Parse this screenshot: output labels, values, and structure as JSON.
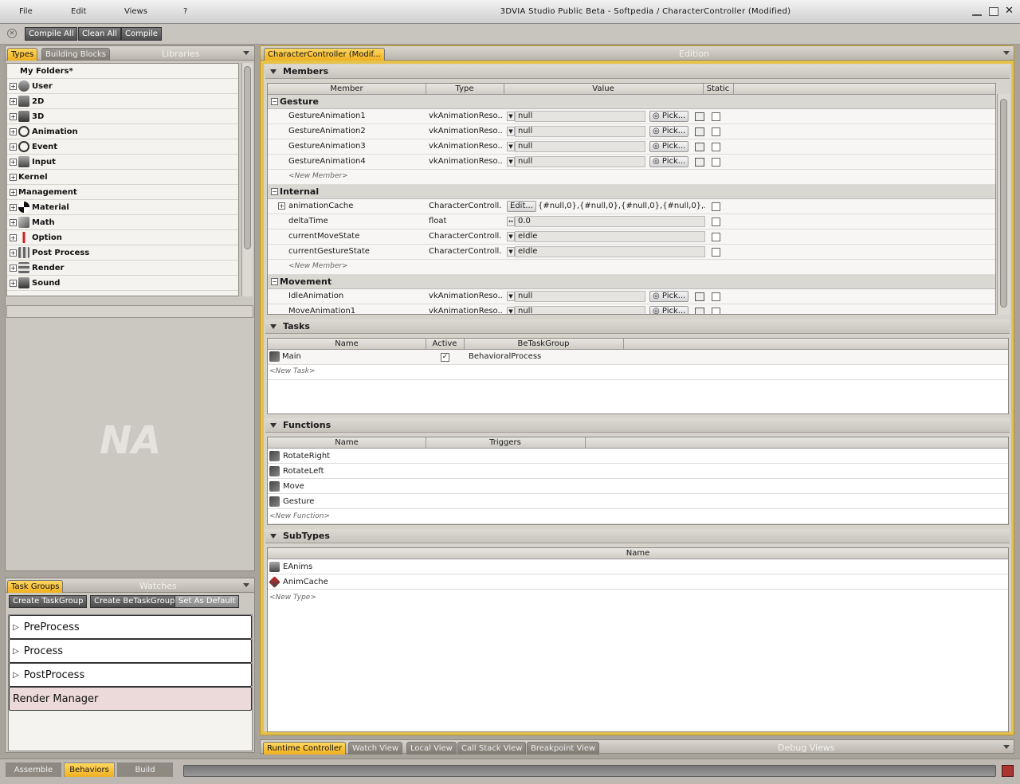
{
  "app": {
    "title": "3DVIA Studio  Public Beta  -  Softpedia  /  CharacterController  (Modified)",
    "menu": [
      "File",
      "Edit",
      "Views",
      "?"
    ]
  },
  "toolbar": {
    "compile_all": "Compile All",
    "clean_all": "Clean All",
    "compile": "Compile"
  },
  "left_top": {
    "tabs": [
      "Types",
      "Building Blocks"
    ],
    "panel_title": "Libraries",
    "tree": {
      "root": "My Folders*",
      "items": [
        "User",
        "2D",
        "3D",
        "Animation",
        "Event",
        "Input",
        "Kernel",
        "Management",
        "Material",
        "Math",
        "Option",
        "Post Process",
        "Render",
        "Sound"
      ]
    },
    "na_text": "NA"
  },
  "task_groups": {
    "tabs": [
      "Task Groups"
    ],
    "panel_title": "Watches",
    "buttons": [
      "Create TaskGroup",
      "Create BeTaskGroup",
      "Set As Default"
    ],
    "groups": [
      "PreProcess",
      "Process",
      "PostProcess",
      "Render Manager"
    ]
  },
  "editor": {
    "tab": "CharacterController (Modif...",
    "panel_title": "Edition",
    "members": {
      "section": "Members",
      "columns": [
        "Member",
        "Type",
        "Value",
        "Static"
      ],
      "new_member": "<New Member>",
      "pick": "Pick...",
      "edit": "Edit...",
      "groups": [
        {
          "name": "Gesture",
          "rows": [
            {
              "member": "GestureAnimation1",
              "type": "vkAnimationReso...",
              "value": "null"
            },
            {
              "member": "GestureAnimation2",
              "type": "vkAnimationReso...",
              "value": "null"
            },
            {
              "member": "GestureAnimation3",
              "type": "vkAnimationReso...",
              "value": "null"
            },
            {
              "member": "GestureAnimation4",
              "type": "vkAnimationReso...",
              "value": "null"
            }
          ]
        },
        {
          "name": "Internal",
          "rows": [
            {
              "member": "animationCache",
              "type": "CharacterControll...",
              "value": "{#null,0},{#null,0},{#null,0},{#null,0},..."
            },
            {
              "member": "deltaTime",
              "type": "float",
              "value": "0.0"
            },
            {
              "member": "currentMoveState",
              "type": "CharacterControll...",
              "value": "eIdle"
            },
            {
              "member": "currentGestureState",
              "type": "CharacterControll...",
              "value": "eIdle"
            }
          ]
        },
        {
          "name": "Movement",
          "rows": [
            {
              "member": "IdleAnimation",
              "type": "vkAnimationReso...",
              "value": "null"
            },
            {
              "member": "MoveAnimation1",
              "type": "vkAnimationReso...",
              "value": "null"
            }
          ]
        }
      ]
    },
    "tasks": {
      "section": "Tasks",
      "columns": [
        "Name",
        "Active",
        "BeTaskGroup"
      ],
      "rows": [
        {
          "name": "Main",
          "group": "BehavioralProcess"
        }
      ],
      "new": "<New Task>"
    },
    "functions": {
      "section": "Functions",
      "columns": [
        "Name",
        "Triggers"
      ],
      "rows": [
        "RotateRight",
        "RotateLeft",
        "Move",
        "Gesture"
      ],
      "new": "<New Function>"
    },
    "subtypes": {
      "section": "SubTypes",
      "columns": [
        "Name"
      ],
      "rows": [
        "EAnims",
        "AnimCache"
      ],
      "new": "<New Type>"
    }
  },
  "debug": {
    "tabs": [
      "Runtime Controller",
      "Watch View",
      "Local View",
      "Call Stack View",
      "Breakpoint View"
    ],
    "panel_title": "Debug Views"
  },
  "bottom_tabs": [
    "Assemble",
    "Behaviors",
    "Build"
  ],
  "colors": {
    "accent": "#f5c030",
    "panel": "#cbc8c2",
    "titlebar": "#e0e0e0"
  }
}
